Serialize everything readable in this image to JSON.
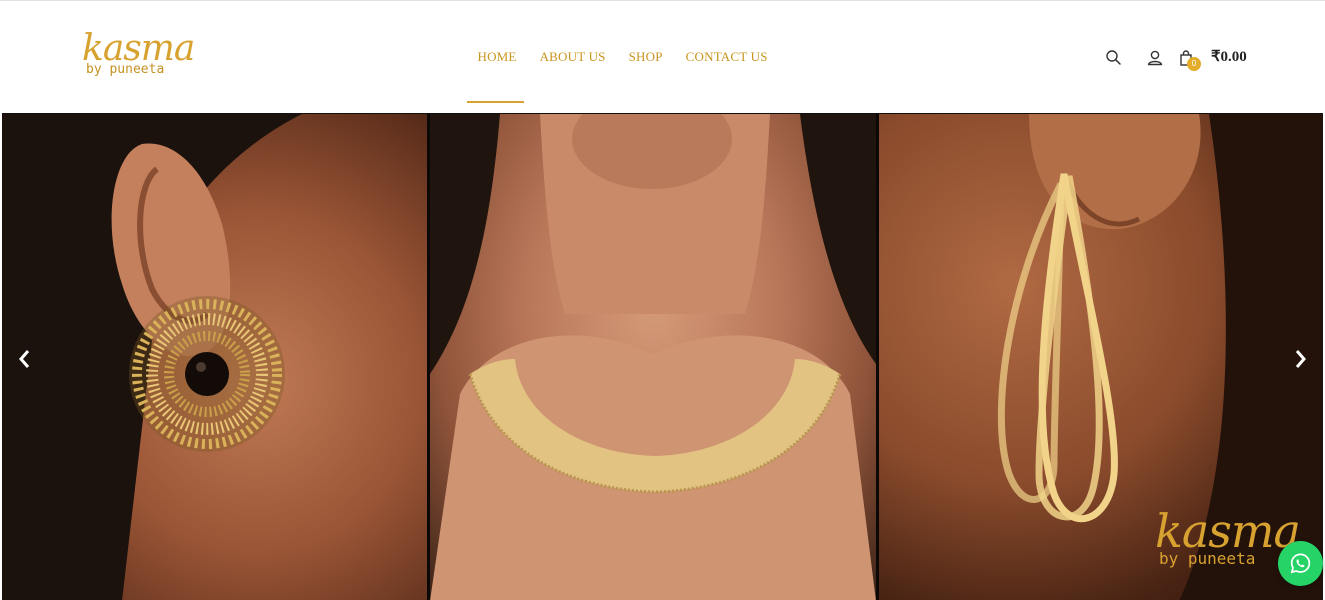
{
  "brand": {
    "logo_script": "kasma",
    "logo_sub": "by puneeta",
    "accent_color": "#d8a230"
  },
  "nav": {
    "items": [
      {
        "label": "HOME",
        "active": true
      },
      {
        "label": "ABOUT US",
        "active": false
      },
      {
        "label": "SHOP",
        "active": false
      },
      {
        "label": "CONTACT US",
        "active": false
      }
    ]
  },
  "header_actions": {
    "search_icon": "search-icon",
    "account_icon": "user-icon",
    "cart_icon": "shopping-bag-icon",
    "cart_count": "0",
    "cart_total": "₹0.00"
  },
  "slider": {
    "prev_icon": "chevron-left-icon",
    "next_icon": "chevron-right-icon",
    "slides": [
      {
        "subject": "sunburst gold earring with black stone"
      },
      {
        "subject": "gold collar necklace"
      },
      {
        "subject": "triple loop gold hoop earrings"
      }
    ],
    "watermark_script": "kasma",
    "watermark_sub": "by puneeta"
  },
  "floating": {
    "whatsapp_icon": "whatsapp-icon",
    "whatsapp_color": "#25d366"
  }
}
